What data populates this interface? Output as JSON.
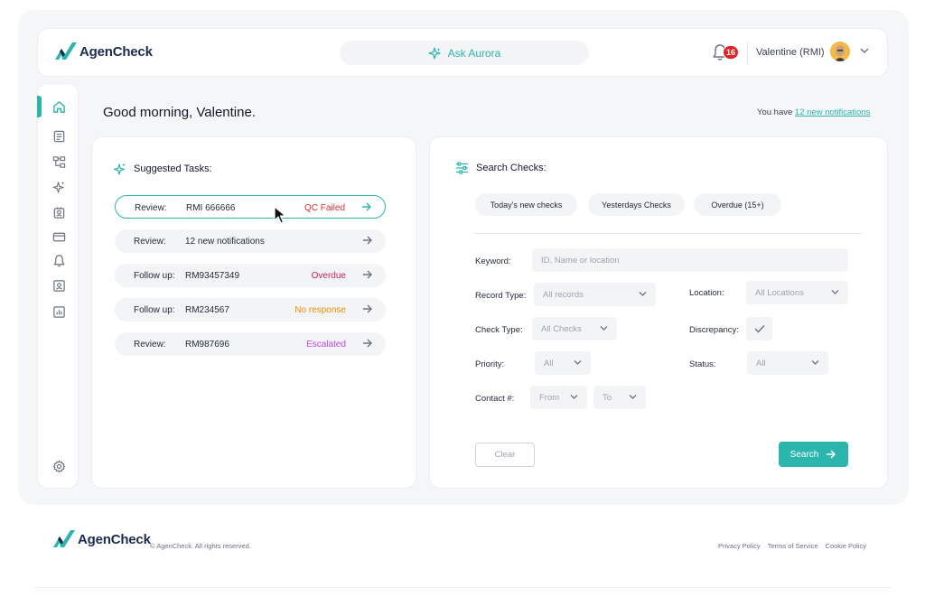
{
  "brand": {
    "name": "AgenCheck",
    "accent": "#2bb5ad",
    "navy": "#1d2b4f"
  },
  "header": {
    "ask_label": "Ask Aurora",
    "notification_count": "16",
    "user_name": "Valentine (RMI)"
  },
  "sidebar": {
    "items": [
      {
        "icon": "home-icon",
        "active": true
      },
      {
        "icon": "clipboard-icon"
      },
      {
        "icon": "hierarchy-icon"
      },
      {
        "icon": "sparkle-icon"
      },
      {
        "icon": "badge-icon"
      },
      {
        "icon": "credit-card-icon"
      },
      {
        "icon": "bell-icon"
      },
      {
        "icon": "id-card-icon"
      },
      {
        "icon": "report-icon"
      }
    ],
    "settings_icon": "gear-icon"
  },
  "greeting": "Good morning, Valentine.",
  "notifications": {
    "prefix": "You have ",
    "link": "12 new notifications"
  },
  "suggested": {
    "title": "Suggested Tasks:",
    "tasks": [
      {
        "type": "Review:",
        "id": "RMI 666666",
        "status": "QC Failed",
        "status_color": "#e03131"
      },
      {
        "type": "Review:",
        "id": "12 new notifications",
        "status": "",
        "status_color": ""
      },
      {
        "type": "Follow up:",
        "id": "RM93457349",
        "status": "Overdue",
        "status_color": "#c2255c"
      },
      {
        "type": "Follow up:",
        "id": "RM234567",
        "status": "No response",
        "status_color": "#f08c00"
      },
      {
        "type": "Review:",
        "id": "RM987696",
        "status": "Escalated",
        "status_color": "#be4bdb"
      }
    ]
  },
  "search": {
    "title": "Search Checks:",
    "quick_filters": [
      "Today's new checks",
      "Yesterdays Checks",
      "Overdue (15+)"
    ],
    "keyword_label": "Keyword:",
    "keyword_placeholder": "ID, Name or location",
    "record_type_label": "Record Type:",
    "record_type_value": "All records",
    "location_label": "Location:",
    "location_value": "All Locations",
    "check_type_label": "Check Type:",
    "check_type_value": "All Checks",
    "discrepancy_label": "Discrepancy:",
    "priority_label": "Priority:",
    "priority_value": "All",
    "status_label": "Status:",
    "status_value": "All",
    "contact_label": "Contact #:",
    "contact_from": "From",
    "contact_to": "To",
    "clear_label": "Clear",
    "search_label": "Search"
  },
  "footer": {
    "copyright": "© AgenCheck. All rights reserved.",
    "links": [
      "Privacy Policy",
      "Terms of Service",
      "Cookie Policy"
    ]
  }
}
